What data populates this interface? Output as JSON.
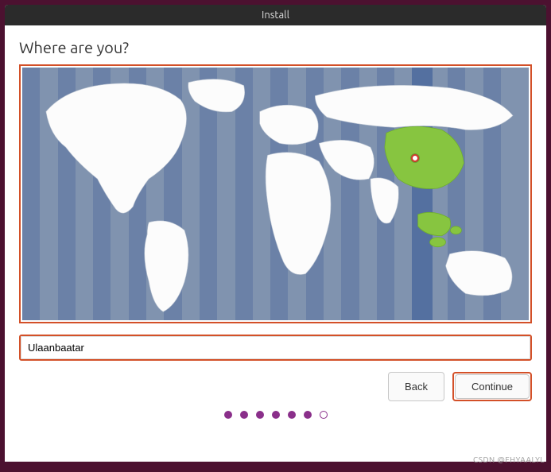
{
  "window": {
    "title": "Install"
  },
  "heading": "Where are you?",
  "timezone": {
    "value": "Ulaanbaatar"
  },
  "map": {
    "selected_region_color": "#87c540",
    "ocean_color": "#8093af",
    "land_color": "#fcfcfc",
    "location_marker": "Ulaanbaatar"
  },
  "buttons": {
    "back": "Back",
    "continue": "Continue"
  },
  "progress": {
    "total": 7,
    "current": 6
  },
  "watermark": "CSDN @FHYAALYL"
}
